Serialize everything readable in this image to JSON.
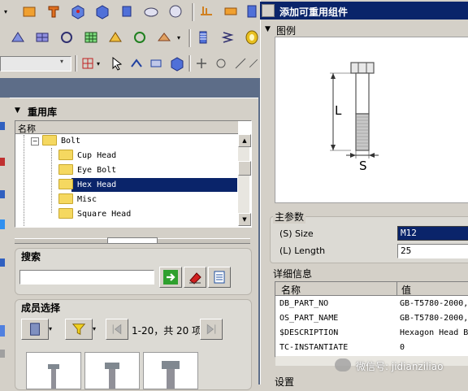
{
  "dialog": {
    "title": "添加可重用组件",
    "preview_label": "图例",
    "dimension_length": "L",
    "dimension_size": "S"
  },
  "library": {
    "title": "重用库",
    "column_name": "名称",
    "tree": [
      {
        "label": "Bolt",
        "level": 0,
        "selected": false
      },
      {
        "label": "Cup Head",
        "level": 1,
        "selected": false
      },
      {
        "label": "Eye Bolt",
        "level": 1,
        "selected": false
      },
      {
        "label": "Hex Head",
        "level": 1,
        "selected": true
      },
      {
        "label": "Misc",
        "level": 1,
        "selected": false
      },
      {
        "label": "Square Head",
        "level": 1,
        "selected": false
      }
    ]
  },
  "search": {
    "title": "搜索",
    "input_value": ""
  },
  "members": {
    "title": "成员选择",
    "range_text": "1-20，共 20 项"
  },
  "main_params": {
    "title": "主参数",
    "size_label": "(S) Size",
    "size_value": "M12",
    "length_label": "(L) Length",
    "length_value": "25"
  },
  "details": {
    "title": "详细信息",
    "col_name": "名称",
    "col_value": "值",
    "rows": [
      {
        "name": "DB_PART_NO",
        "value": "GB-T5780-2000,"
      },
      {
        "name": "OS_PART_NAME",
        "value": "GB-T5780-2000,"
      },
      {
        "name": "$DESCRIPTION",
        "value": "Hexagon Head B"
      },
      {
        "name": "TC-INSTANTIATE",
        "value": "0"
      }
    ]
  },
  "settings_label": "设置",
  "watermark": "微信号: jidianziliao",
  "colors": {
    "title_bar": "#0a246a",
    "selection": "#0a246a",
    "folder": "#f5d860"
  }
}
